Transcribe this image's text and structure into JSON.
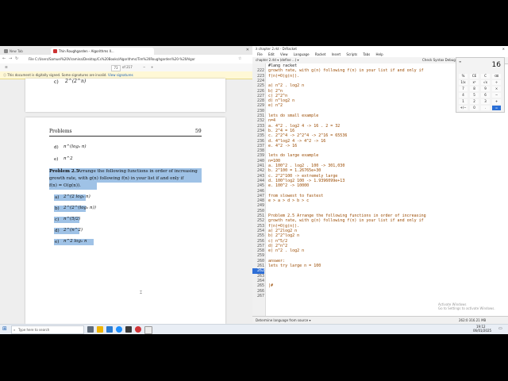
{
  "browser": {
    "tabs": [
      {
        "label": "New Tab"
      },
      {
        "label": "Thin Roughgarden - Algorithms Il..."
      }
    ],
    "address_url": "File  C:/Users/Samuel%20Viramina/Desktop/Cs%20Books/Algorithms/Tim%20Roughgarden%20-%20Algorithms%20Illuminated_%20Omnibus...",
    "pdf_toolbar": {
      "page_input": "73",
      "page_total": "of 217",
      "zoom": "+",
      "minus": "−"
    },
    "notice": {
      "text": "This document is digitally signed. Some signatures are invalid.",
      "link": "View signatures"
    },
    "page_top": {
      "item_c": "c)",
      "item_c_math": "2^(2^n)"
    },
    "page_main": {
      "header_left": "Problems",
      "header_right": "59",
      "items_before": [
        {
          "label": "d)",
          "math": "n^(log₂ n)"
        },
        {
          "label": "e)",
          "math": "n^2"
        }
      ],
      "problem_title": "Problem 2.5",
      "problem_text_1": "Arrange the following functions in order of increasing",
      "problem_text_2": "growth rate, with g(n) following f(n) in your list if and only if",
      "problem_text_3": "f(n) = O(g(n)).",
      "items_after": [
        {
          "label": "a)",
          "math": "2^(2 log₂ n)"
        },
        {
          "label": "b)",
          "math": "2^(2^(log₂ n))"
        },
        {
          "label": "c)",
          "math": "n^(5/2)"
        },
        {
          "label": "d)",
          "math": "2^(n^2)"
        },
        {
          "label": "e)",
          "math": "n^2 log₂ n"
        }
      ]
    }
  },
  "racket": {
    "title": "chapter 2.rkt - DrRacket",
    "menus": [
      "File",
      "Edit",
      "View",
      "Language",
      "Racket",
      "Insert",
      "Scripts",
      "Tabs",
      "Help"
    ],
    "toolbar_left": "chapter 2.rkt ▾  (define ...) ▾",
    "toolbar_right": "Check Syntax  Debug  Macro Stepper  Run  Stop",
    "lang_line": "#lang racket",
    "lines": [
      {
        "n": "222",
        "t": "growth rate, with g(n) following f(n) in your list if and only if"
      },
      {
        "n": "223",
        "t": "f(n)=O(g(n))."
      },
      {
        "n": "224",
        "t": ""
      },
      {
        "n": "225",
        "t": "a) n^2 . log2 n"
      },
      {
        "n": "226",
        "t": "b) 2^n"
      },
      {
        "n": "227",
        "t": "c) 2^2^n"
      },
      {
        "n": "228",
        "t": "d) n^log2 n"
      },
      {
        "n": "229",
        "t": "e) n^2"
      },
      {
        "n": "230",
        "t": ""
      },
      {
        "n": "231",
        "t": "lets do small example"
      },
      {
        "n": "232",
        "t": "n=4"
      },
      {
        "n": "233",
        "t": "a. 4^2 . log2 4 -> 16 . 2 = 32"
      },
      {
        "n": "234",
        "t": "b. 2^4 = 16"
      },
      {
        "n": "235",
        "t": "c. 2^2^4 -> 2^2^4 -> 2^16 = 65536"
      },
      {
        "n": "236",
        "t": "d. 4^log2 4 -> 4^2 -> 16"
      },
      {
        "n": "237",
        "t": "e. 4^2 -> 16"
      },
      {
        "n": "238",
        "t": ""
      },
      {
        "n": "239",
        "t": "lets do large example"
      },
      {
        "n": "240",
        "t": "n=100"
      },
      {
        "n": "241",
        "t": "a. 100^2 . log2 . 100 -> 301,030"
      },
      {
        "n": "242",
        "t": "b. 2^100 = 1.26765e+30"
      },
      {
        "n": "243",
        "t": "c. 2^2^100 -> extremely large"
      },
      {
        "n": "244",
        "t": "d. 100^log2 100 -> 1.9396099e+13"
      },
      {
        "n": "245",
        "t": "e. 100^2 -> 10000"
      },
      {
        "n": "246",
        "t": ""
      },
      {
        "n": "247",
        "t": "from slowest to fastest"
      },
      {
        "n": "248",
        "t": "e > a > d > b > c"
      },
      {
        "n": "249",
        "t": ""
      },
      {
        "n": "250",
        "t": ""
      },
      {
        "n": "251",
        "t": "Problem 2.5 Arrange the following functions in order of increasing"
      },
      {
        "n": "252",
        "t": "growth rate, with g(n) following f(n) in your list if and only if"
      },
      {
        "n": "253",
        "t": "f(n)=O(g(n))."
      },
      {
        "n": "254",
        "t": "a) 2^2log2 n"
      },
      {
        "n": "255",
        "t": "b) 2^2^log2 n"
      },
      {
        "n": "256",
        "t": "c) n^5/2"
      },
      {
        "n": "257",
        "t": "d) 2^n^2"
      },
      {
        "n": "258",
        "t": "e) n^2 . log2 n"
      },
      {
        "n": "259",
        "t": ""
      },
      {
        "n": "260",
        "t": "answer:"
      },
      {
        "n": "261",
        "t": "lets try large n = 100"
      },
      {
        "n": "262",
        "t": ""
      },
      {
        "n": "263",
        "t": ""
      },
      {
        "n": "264",
        "t": ""
      },
      {
        "n": "265",
        "t": "|#"
      },
      {
        "n": "266",
        "t": ""
      },
      {
        "n": "267",
        "t": ""
      }
    ],
    "status_left": "Determine language from source ▾",
    "status_right": "262:0   316.21 MB",
    "watermark_1": "Activate Windows",
    "watermark_2": "Go to Settings to activate Windows."
  },
  "calculator": {
    "display": "16",
    "buttons": [
      "%",
      "CE",
      "C",
      "⌫",
      "1/x",
      "x²",
      "√x",
      "÷",
      "7",
      "8",
      "9",
      "×",
      "4",
      "5",
      "6",
      "−",
      "1",
      "2",
      "3",
      "+",
      "+/−",
      "0",
      ".",
      "="
    ]
  },
  "taskbar": {
    "search": "Type here to search",
    "time": "19:12",
    "date": "06/01/2025"
  },
  "colors": {
    "racket_text": "#9a4a00",
    "highlight": "#9fc2e6",
    "accent": "#2b6fd6"
  }
}
